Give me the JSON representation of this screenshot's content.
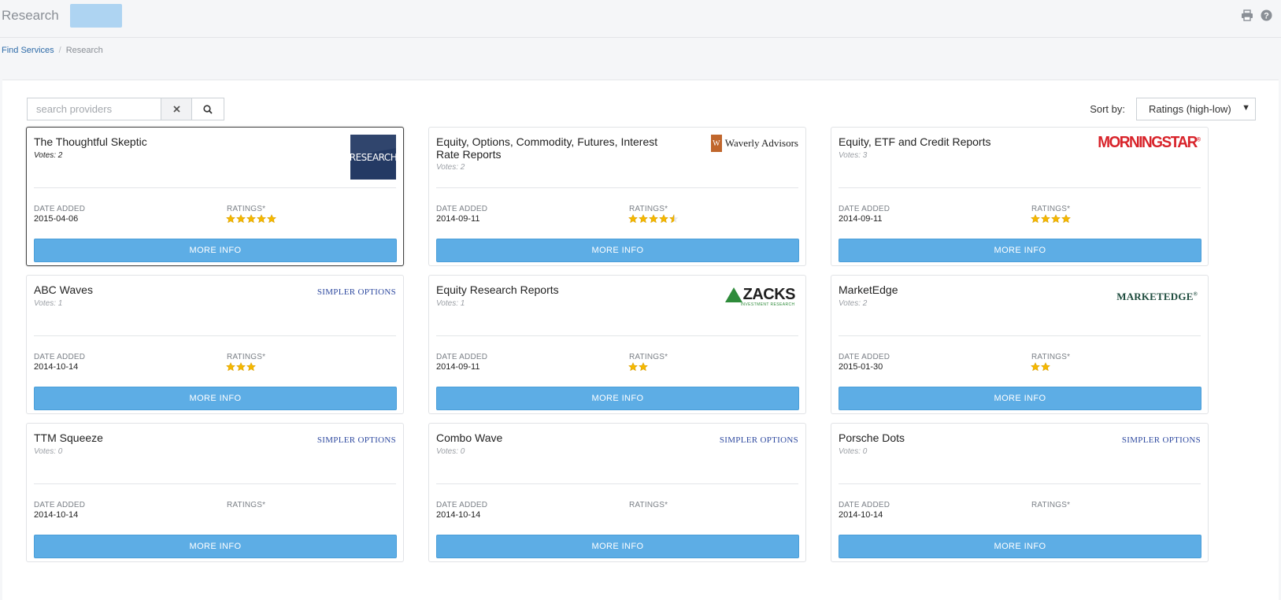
{
  "header": {
    "title": "Research",
    "print_icon": "printer-icon",
    "help_icon": "help-circle-icon"
  },
  "breadcrumb": {
    "link": "Find Services",
    "separator": "/",
    "current": "Research"
  },
  "search": {
    "placeholder": "search providers",
    "value": "",
    "clear_icon": "close-icon",
    "search_icon": "search-icon"
  },
  "sort": {
    "label": "Sort by:",
    "selected": "Ratings (high-low)"
  },
  "labels": {
    "date_added": "DATE ADDED",
    "ratings": "RATINGS*",
    "more_info": "MORE INFO"
  },
  "colors": {
    "accent_button": "#5dade5",
    "star": "#f5b800",
    "link": "#2e6ba8"
  },
  "cards": [
    {
      "title": "The Thoughtful Skeptic",
      "votes": "Votes: 2",
      "date": "2015-04-06",
      "rating": 5,
      "logo": "RESEARCH",
      "logo_type": "research"
    },
    {
      "title": "Equity, Options, Commodity, Futures, Interest Rate Reports",
      "votes": "Votes: 2",
      "date": "2014-09-11",
      "rating": 4.5,
      "logo": "Waverly Advisors",
      "logo_type": "waverly"
    },
    {
      "title": "Equity, ETF and Credit Reports",
      "votes": "Votes: 3",
      "date": "2014-09-11",
      "rating": 4,
      "logo": "MORNINGSTAR",
      "logo_type": "morningstar"
    },
    {
      "title": "ABC Waves",
      "votes": "Votes: 1",
      "date": "2014-10-14",
      "rating": 3,
      "logo": "SIMPLER OPTIONS",
      "logo_type": "simpler"
    },
    {
      "title": "Equity Research Reports",
      "votes": "Votes: 1",
      "date": "2014-09-11",
      "rating": 2,
      "logo": "ZACKS",
      "logo_sub": "INVESTMENT RESEARCH",
      "logo_type": "zacks"
    },
    {
      "title": "MarketEdge",
      "votes": "Votes: 2",
      "date": "2015-01-30",
      "rating": 2,
      "logo": "MARKETEDGE",
      "logo_type": "marketedge"
    },
    {
      "title": "TTM Squeeze",
      "votes": "Votes: 0",
      "date": "2014-10-14",
      "rating": 0,
      "logo": "SIMPLER OPTIONS",
      "logo_type": "simpler"
    },
    {
      "title": "Combo Wave",
      "votes": "Votes: 0",
      "date": "2014-10-14",
      "rating": 0,
      "logo": "SIMPLER OPTIONS",
      "logo_type": "simpler"
    },
    {
      "title": "Porsche Dots",
      "votes": "Votes: 0",
      "date": "2014-10-14",
      "rating": 0,
      "logo": "SIMPLER OPTIONS",
      "logo_type": "simpler"
    }
  ]
}
